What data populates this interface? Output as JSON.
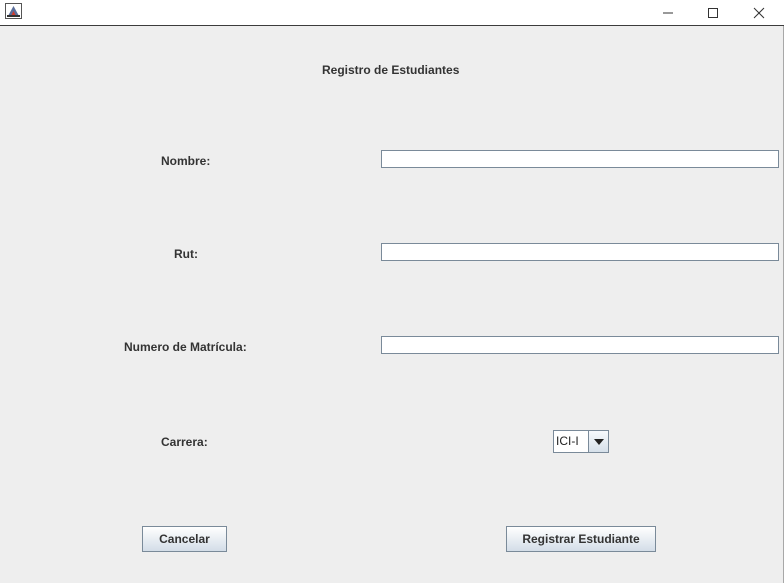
{
  "window": {
    "minimize_glyph": "—",
    "maximize_glyph": "☐",
    "close_glyph": "✕"
  },
  "form": {
    "title": "Registro de Estudiantes",
    "fields": {
      "nombre": {
        "label": "Nombre:",
        "value": ""
      },
      "rut": {
        "label": "Rut:",
        "value": ""
      },
      "matricula": {
        "label": "Numero de Matrícula:",
        "value": ""
      }
    },
    "carrera": {
      "label": "Carrera:",
      "selected": "ICI-I"
    },
    "buttons": {
      "cancel": "Cancelar",
      "register": "Registrar Estudiante"
    }
  },
  "colors": {
    "background": "#eeeeee",
    "field_border": "#7a8a99",
    "label_text": "#333333"
  },
  "icons": {
    "app": "java-app-icon",
    "minimize": "minimize-icon",
    "maximize": "maximize-icon",
    "close": "close-icon",
    "dropdown": "dropdown-arrow-icon"
  }
}
